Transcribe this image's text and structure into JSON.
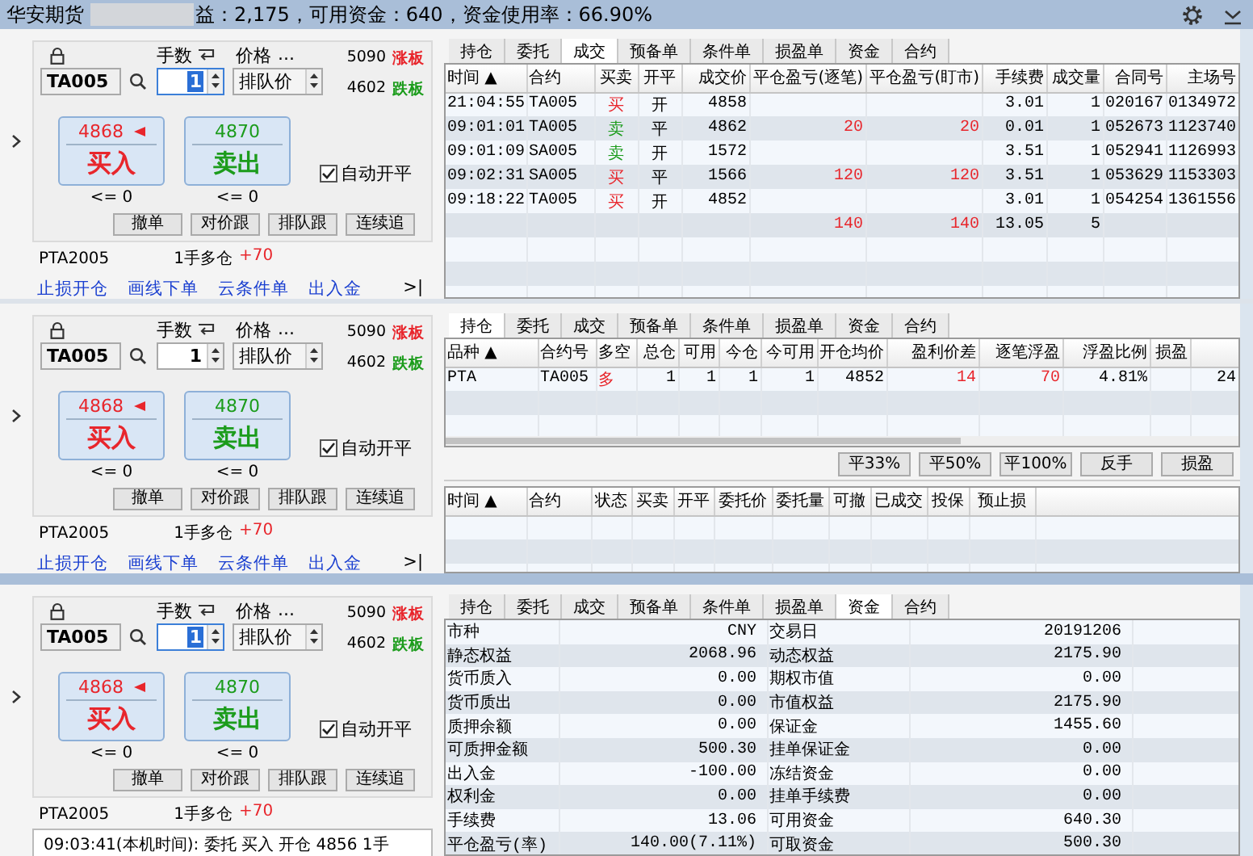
{
  "title_bar": {
    "brand": "华安期货",
    "summary": "益：2,175，可用资金：640，资金使用率：66.90%"
  },
  "sections": [
    {
      "order_panel": {
        "contract": "TA005",
        "quantity_label": "手数",
        "quantity": "1",
        "quantity_focused": true,
        "price_label": "价格",
        "price_more": "...",
        "price_type": "排队价",
        "limit_up": "5090",
        "limit_up_label": "涨板",
        "limit_down": "4602",
        "limit_down_label": "跌板",
        "buy": {
          "price": "4868",
          "label": "买入",
          "limit": "<= 0"
        },
        "sell": {
          "price": "4870",
          "label": "卖出",
          "limit": "<= 0"
        },
        "auto_open_close": {
          "label": "自动开平",
          "checked": true
        },
        "actions": [
          "撤单",
          "对价跟",
          "排队跟",
          "连续追"
        ],
        "position": {
          "symbol": "PTA2005",
          "summary": "1手多仓",
          "pnl": "+70"
        }
      },
      "footer": {
        "kind": "links",
        "links": [
          "止损开仓",
          "画线下单",
          "云条件单",
          "出入金"
        ],
        "end": ">|"
      },
      "tabs": [
        {
          "label": "持仓",
          "selected": false
        },
        {
          "label": "委托",
          "selected": false
        },
        {
          "label": "成交",
          "selected": true
        },
        {
          "label": "预备单",
          "selected": false
        },
        {
          "label": "条件单",
          "selected": false
        },
        {
          "label": "损盈单",
          "selected": false
        },
        {
          "label": "资金",
          "selected": false
        },
        {
          "label": "合约",
          "selected": false
        }
      ],
      "content": {
        "kind": "trades",
        "columns": [
          "时间 ▲",
          "合约",
          "买卖",
          "开平",
          "成交价",
          "平仓盈亏(逐笔)",
          "平仓盈亏(盯市)",
          "手续费",
          "成交量",
          "合同号",
          "主场号"
        ],
        "rows": [
          {
            "kind": "trade",
            "color": "#e8262c",
            "cells": [
              "21:04:55",
              "TA005",
              "买",
              "开",
              "4858",
              null,
              null,
              "3.01",
              "1",
              "020167",
              "0134972"
            ]
          },
          {
            "kind": "trade",
            "color": "#1c9c1c",
            "cells": [
              "09:01:01",
              "TA005",
              "卖",
              "平",
              "4862",
              "20",
              "20",
              "0.01",
              "1",
              "052673",
              "1123740"
            ]
          },
          {
            "kind": "trade",
            "color": "#1c9c1c",
            "cells": [
              "09:01:09",
              "SA005",
              "卖",
              "开",
              "1572",
              null,
              null,
              "3.51",
              "1",
              "052941",
              "1126993"
            ]
          },
          {
            "kind": "trade",
            "color": "#e8262c",
            "cells": [
              "09:02:31",
              "SA005",
              "买",
              "平",
              "1566",
              "120",
              "120",
              "3.51",
              "1",
              "053629",
              "1153303"
            ]
          },
          {
            "kind": "trade",
            "color": "#e8262c",
            "cells": [
              "09:18:22",
              "TA005",
              "买",
              "开",
              "4852",
              null,
              null,
              "3.01",
              "1",
              "054254",
              "1361556"
            ]
          },
          {
            "kind": "total",
            "cells": [
              null,
              null,
              null,
              null,
              null,
              "140",
              "140",
              "13.05",
              "5",
              null,
              null
            ]
          }
        ]
      }
    },
    {
      "order_panel": {
        "contract": "TA005",
        "quantity_label": "手数",
        "quantity": "1",
        "quantity_focused": false,
        "price_label": "价格",
        "price_more": "...",
        "price_type": "排队价",
        "limit_up": "5090",
        "limit_up_label": "涨板",
        "limit_down": "4602",
        "limit_down_label": "跌板",
        "buy": {
          "price": "4868",
          "label": "买入",
          "limit": "<= 0"
        },
        "sell": {
          "price": "4870",
          "label": "卖出",
          "limit": "<= 0"
        },
        "auto_open_close": {
          "label": "自动开平",
          "checked": true
        },
        "actions": [
          "撤单",
          "对价跟",
          "排队跟",
          "连续追"
        ],
        "position": {
          "symbol": "PTA2005",
          "summary": "1手多仓",
          "pnl": "+70"
        }
      },
      "footer": {
        "kind": "links",
        "links": [
          "止损开仓",
          "画线下单",
          "云条件单",
          "出入金"
        ],
        "end": ">|"
      },
      "tabs": [
        {
          "label": "持仓",
          "selected": true
        },
        {
          "label": "委托",
          "selected": false
        },
        {
          "label": "成交",
          "selected": false
        },
        {
          "label": "预备单",
          "selected": false
        },
        {
          "label": "条件单",
          "selected": false
        },
        {
          "label": "损盈单",
          "selected": false
        },
        {
          "label": "资金",
          "selected": false
        },
        {
          "label": "合约",
          "selected": false
        }
      ],
      "content": {
        "kind": "positions",
        "columns": [
          "品种 ▲",
          "合约号",
          "多空",
          "总仓",
          "可用",
          "今仓",
          "今可用",
          "开仓均价",
          "盈利价差",
          "逐笔浮盈",
          "浮盈比例",
          "损盈"
        ],
        "rows": [
          {
            "color": "#e8262c",
            "cells": [
              "PTA",
              "TA005",
              "多",
              "1",
              "1",
              "1",
              "1",
              "4852",
              "14",
              "70",
              "4.81%",
              null,
              "24"
            ]
          }
        ],
        "actions": [
          "平33%",
          "平50%",
          "平100%",
          "反手",
          "损盈"
        ],
        "orders": {
          "columns": [
            "时间 ▲",
            "合约",
            "状态",
            "买卖",
            "开平",
            "委托价",
            "委托量",
            "可撤",
            "已成交",
            "投保",
            "预止损"
          ]
        }
      }
    },
    {
      "order_panel": {
        "contract": "TA005",
        "quantity_label": "手数",
        "quantity": "1",
        "quantity_focused": true,
        "price_label": "价格",
        "price_more": "...",
        "price_type": "排队价",
        "limit_up": "5090",
        "limit_up_label": "涨板",
        "limit_down": "4602",
        "limit_down_label": "跌板",
        "buy": {
          "price": "4868",
          "label": "买入",
          "limit": "<= 0"
        },
        "sell": {
          "price": "4870",
          "label": "卖出",
          "limit": "<= 0"
        },
        "auto_open_close": {
          "label": "自动开平",
          "checked": true
        },
        "actions": [
          "撤单",
          "对价跟",
          "排队跟",
          "连续追"
        ],
        "position": {
          "symbol": "PTA2005",
          "summary": "1手多仓",
          "pnl": "+70"
        }
      },
      "footer": {
        "kind": "log",
        "text": "09:03:41(本机时间): 委托 买入 开仓 4856 1手"
      },
      "tabs": [
        {
          "label": "持仓",
          "selected": false
        },
        {
          "label": "委托",
          "selected": false
        },
        {
          "label": "成交",
          "selected": false
        },
        {
          "label": "预备单",
          "selected": false
        },
        {
          "label": "条件单",
          "selected": false
        },
        {
          "label": "损盈单",
          "selected": false
        },
        {
          "label": "资金",
          "selected": true
        },
        {
          "label": "合约",
          "selected": false
        }
      ],
      "content": {
        "kind": "funds",
        "rows": [
          [
            "市种",
            "CNY",
            "交易日",
            "20191206"
          ],
          [
            "静态权益",
            "2068.96",
            "动态权益",
            "2175.90"
          ],
          [
            "货币质入",
            "0.00",
            "期权市值",
            "0.00"
          ],
          [
            "货币质出",
            "0.00",
            "市值权益",
            "2175.90"
          ],
          [
            "质押余额",
            "0.00",
            "保证金",
            "1455.60"
          ],
          [
            "可质押金额",
            "500.30",
            "挂单保证金",
            "0.00"
          ],
          [
            "出入金",
            "-100.00",
            "冻结资金",
            "0.00"
          ],
          [
            "权利金",
            "0.00",
            "挂单手续费",
            "0.00"
          ],
          [
            "手续费",
            "13.06",
            "可用资金",
            "640.30"
          ],
          [
            "平仓盈亏(率)",
            "140.00(7.11%)",
            "可取资金",
            "500.30"
          ]
        ]
      }
    }
  ]
}
